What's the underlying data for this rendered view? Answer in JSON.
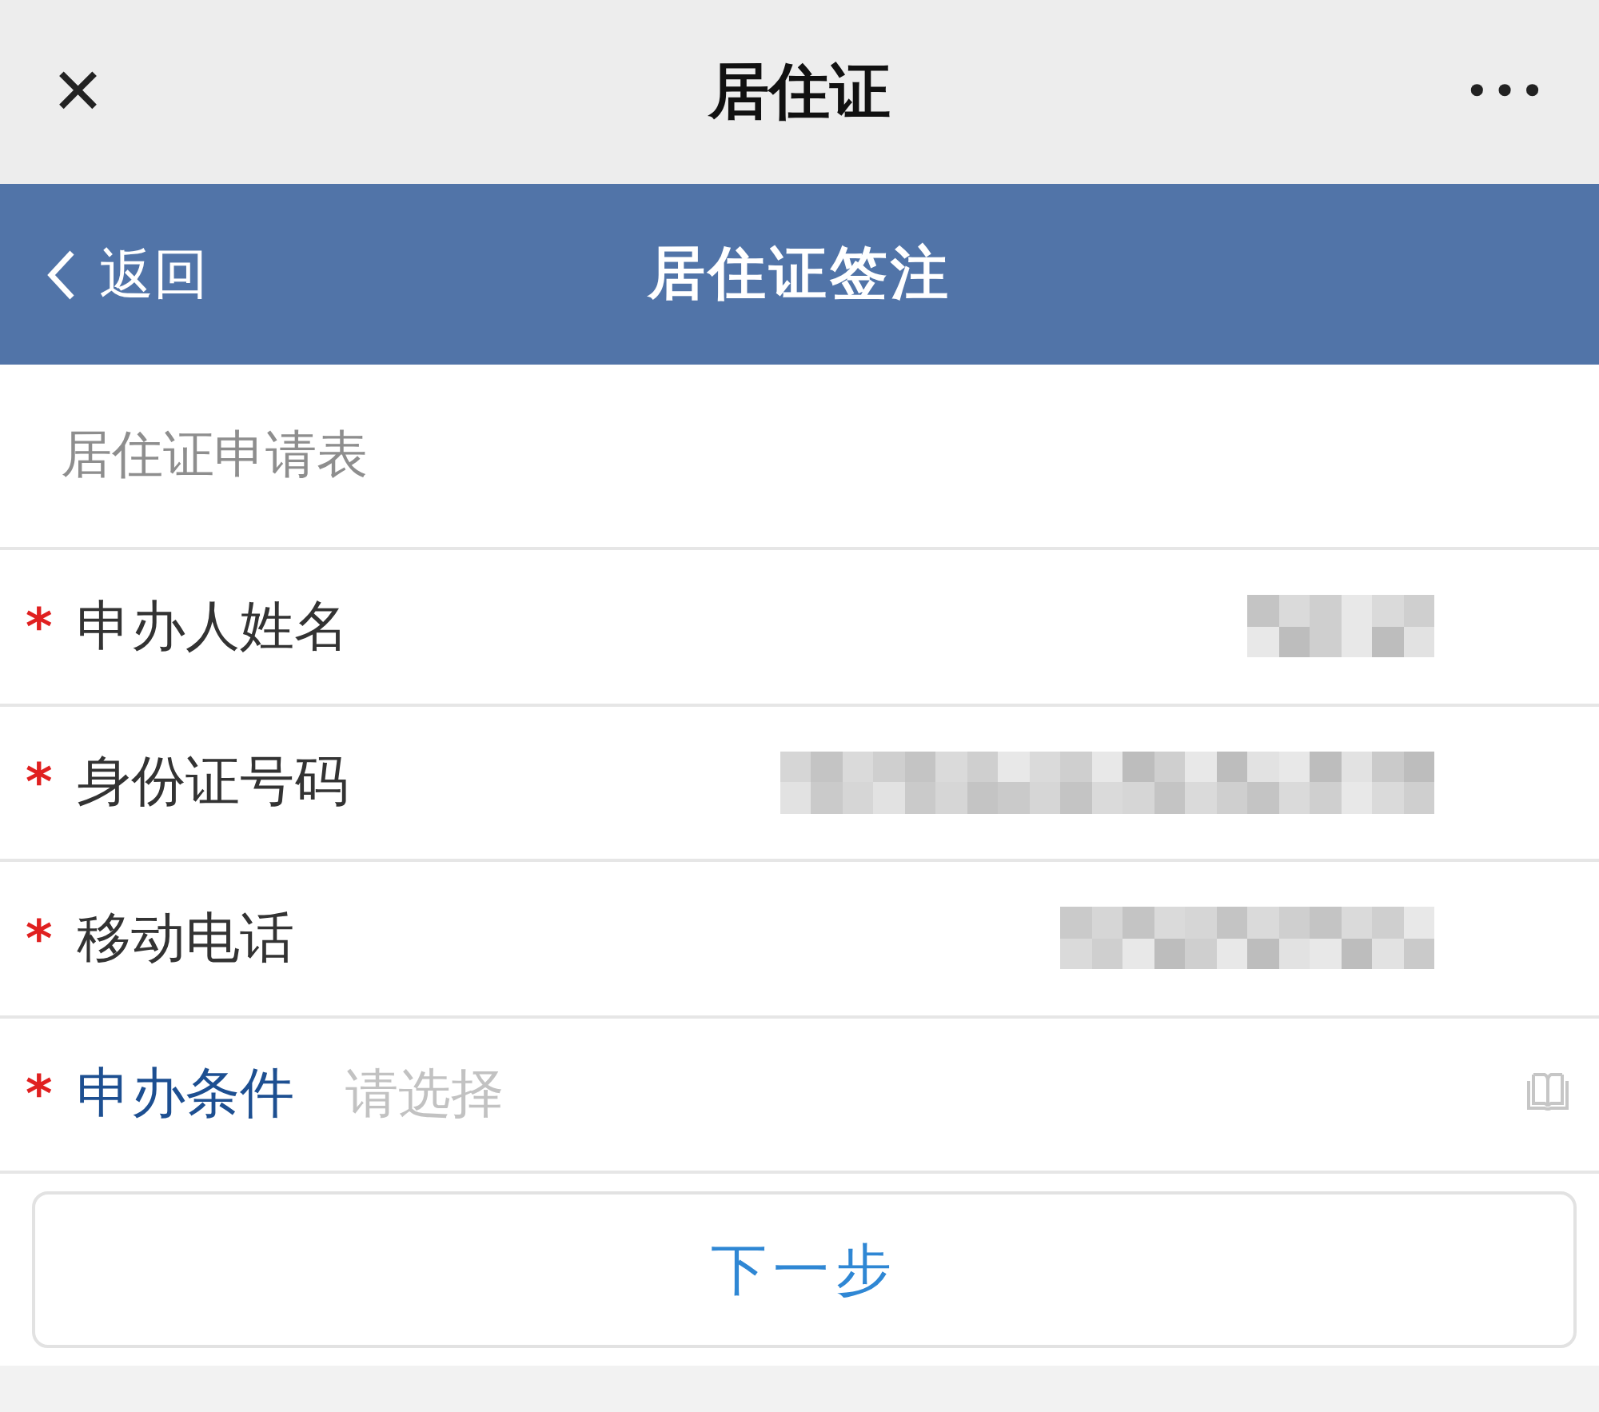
{
  "top_bar": {
    "close": "✕",
    "title": "居住证",
    "more": "•••"
  },
  "header": {
    "back": "返回",
    "title": "居住证签注"
  },
  "section_title": "居住证申请表",
  "fields": [
    {
      "kind": "redacted",
      "required_mark": "*",
      "label": "申办人姓名"
    },
    {
      "kind": "redacted",
      "required_mark": "*",
      "label": "身份证号码"
    },
    {
      "kind": "redacted",
      "required_mark": "*",
      "label": "移动电话"
    },
    {
      "kind": "select",
      "required_mark": "*",
      "label": "申办条件",
      "placeholder": "请选择"
    }
  ],
  "next_button": "下一步"
}
